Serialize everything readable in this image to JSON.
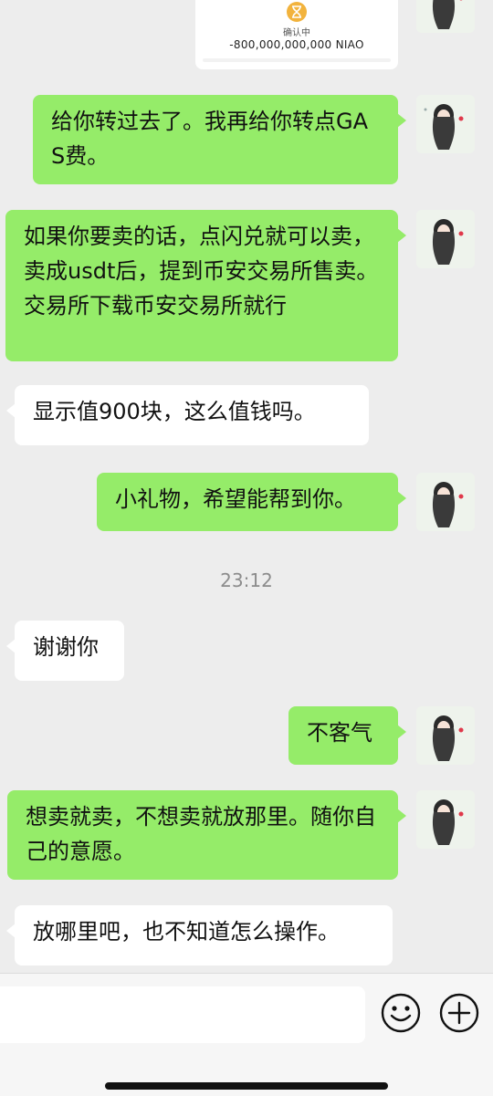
{
  "transfer_card": {
    "status": "确认中",
    "amount": "-800,000,000,000 NIAO"
  },
  "messages": [
    {
      "side": "out",
      "text": "给你转过去了。我再给你转点GAS费。"
    },
    {
      "side": "out",
      "text": "如果你要卖的话，点闪兑就可以卖，卖成usdt后，提到币安交易所售卖。交易所下载币安交易所就行"
    },
    {
      "side": "in",
      "text": "显示值900块，这么值钱吗。"
    },
    {
      "side": "out",
      "text": "小礼物，希望能帮到你。"
    },
    {
      "side": "in",
      "text": "谢谢你"
    },
    {
      "side": "out",
      "text": "不客气"
    },
    {
      "side": "out",
      "text": "想卖就卖，不想卖就放那里。随你自己的意愿。"
    },
    {
      "side": "in",
      "text": "放哪里吧，也不知道怎么操作。"
    }
  ],
  "timestamp": "23:12",
  "colors": {
    "outgoing_bubble": "#95ec69",
    "incoming_bubble": "#ffffff",
    "background": "#ededed"
  },
  "icons": [
    "emoji-icon",
    "plus-icon",
    "hourglass-icon",
    "contact-avatar"
  ]
}
